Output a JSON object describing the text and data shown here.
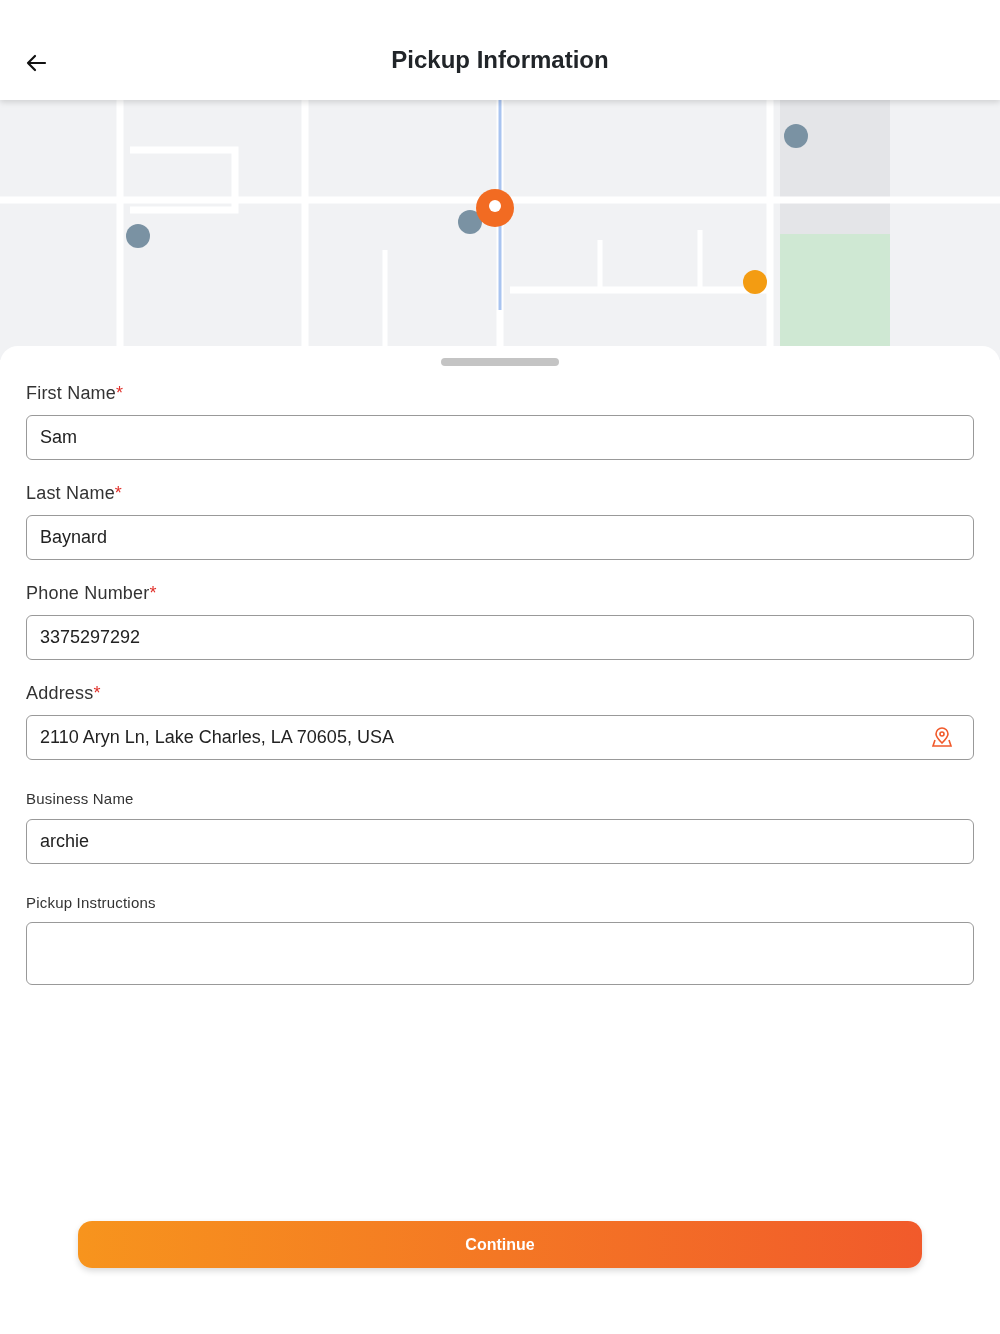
{
  "header": {
    "title": "Pickup Information"
  },
  "fields": [
    {
      "kind": "input",
      "label": "First Name",
      "required_mark": "*",
      "value": "Sam"
    },
    {
      "kind": "input",
      "label": "Last Name",
      "required_mark": "*",
      "value": "Baynard"
    },
    {
      "kind": "input",
      "label": "Phone Number",
      "required_mark": "*",
      "value": "3375297292"
    },
    {
      "kind": "location",
      "label": "Address",
      "required_mark": "*",
      "value": "2110 Aryn Ln, Lake Charles, LA 70605, USA"
    },
    {
      "kind": "input",
      "label": "Business Name",
      "value": "archie"
    },
    {
      "kind": "textarea",
      "label": "Pickup Instructions"
    }
  ],
  "continue_button": {
    "label": "Continue"
  }
}
